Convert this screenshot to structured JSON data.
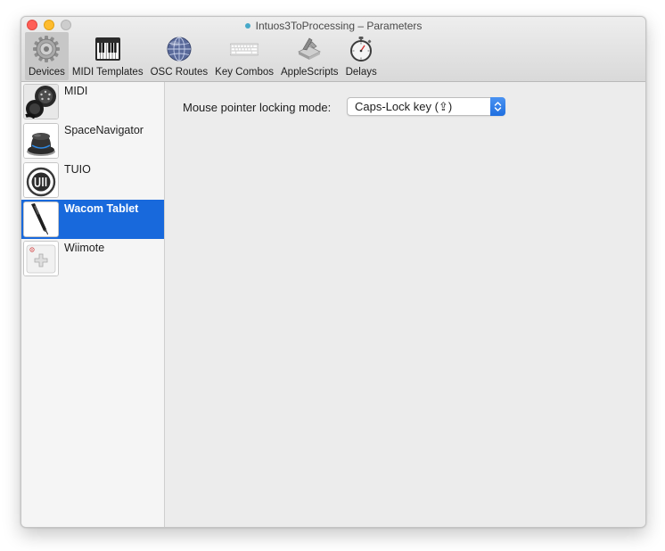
{
  "window": {
    "title": "Intuos3ToProcessing – Parameters"
  },
  "toolbar": {
    "items": [
      {
        "label": "Devices",
        "icon": "gear-icon",
        "selected": true
      },
      {
        "label": "MIDI Templates",
        "icon": "piano-keyboard-icon",
        "selected": false
      },
      {
        "label": "OSC Routes",
        "icon": "globe-icon",
        "selected": false
      },
      {
        "label": "Key Combos",
        "icon": "keyboard-icon",
        "selected": false
      },
      {
        "label": "AppleScripts",
        "icon": "script-icon",
        "selected": false
      },
      {
        "label": "Delays",
        "icon": "stopwatch-icon",
        "selected": false
      }
    ]
  },
  "sidebar": {
    "items": [
      {
        "label": "MIDI",
        "icon": "midi-cable-icon",
        "selected": false
      },
      {
        "label": "SpaceNavigator",
        "icon": "space-navigator-icon",
        "selected": false
      },
      {
        "label": "TUIO",
        "icon": "tuio-icon",
        "selected": false
      },
      {
        "label": "Wacom Tablet",
        "icon": "wacom-pen-icon",
        "selected": true
      },
      {
        "label": "Wiimote",
        "icon": "wiimote-icon",
        "selected": false
      }
    ]
  },
  "content": {
    "locking_label": "Mouse pointer locking mode:",
    "locking_value": "Caps-Lock key (⇪)"
  },
  "colors": {
    "selection": "#1869dc",
    "popup_accent": "#2c7ae6"
  }
}
